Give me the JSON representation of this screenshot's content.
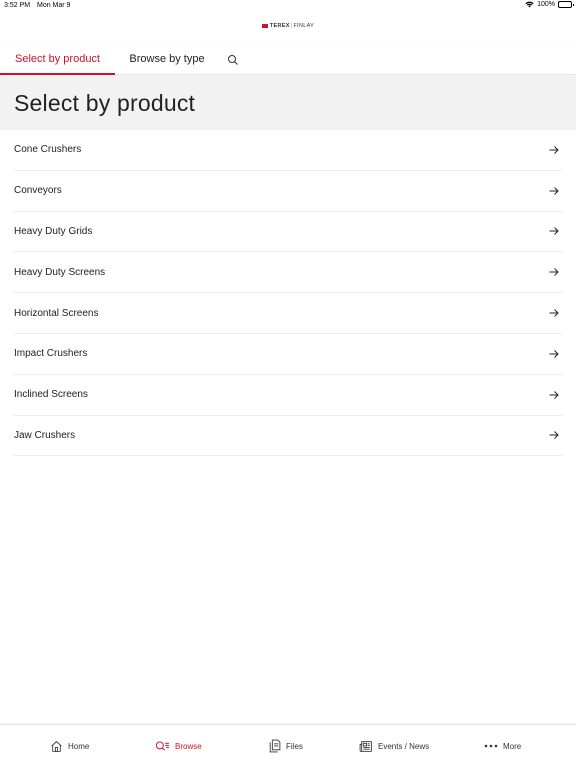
{
  "status_bar": {
    "time": "3:52 PM",
    "date": "Mon Mar 9",
    "battery": "100%"
  },
  "brand": {
    "name_part1": "TEREX",
    "separator": "|",
    "name_part2": "FINLAY"
  },
  "tabs": {
    "select_by_product": "Select by product",
    "browse_by_type": "Browse by type",
    "search_icon": "search-icon"
  },
  "page": {
    "title": "Select by product"
  },
  "products": [
    {
      "label": "Cone Crushers"
    },
    {
      "label": "Conveyors"
    },
    {
      "label": "Heavy Duty Grids"
    },
    {
      "label": "Heavy Duty Screens"
    },
    {
      "label": "Horizontal Screens"
    },
    {
      "label": "Impact Crushers"
    },
    {
      "label": "Inclined Screens"
    },
    {
      "label": "Jaw Crushers"
    }
  ],
  "bottom_nav": {
    "home": "Home",
    "browse": "Browse",
    "files": "Files",
    "events": "Events / News",
    "more": "More"
  },
  "colors": {
    "accent": "#d0102a",
    "header_bg": "#f2f2f2"
  }
}
